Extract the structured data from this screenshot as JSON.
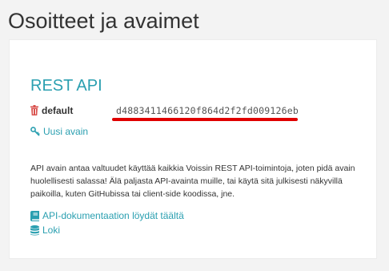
{
  "page": {
    "title": "Osoitteet ja avaimet"
  },
  "rest_api": {
    "title": "REST API",
    "key": {
      "name": "default",
      "value": "d4883411466120f864d2f2fd009126eb",
      "delete_icon": "trash-icon"
    },
    "new_key": {
      "label": "Uusi avain",
      "icon": "key-icon"
    },
    "description": "API avain antaa valtuudet käyttää kaikkia Voissin REST API-toimintoja, joten pidä avain huolellisesti salassa! Älä paljasta API-avainta muille, tai käytä sitä julkisesti näkyvillä paikoilla, kuten GitHubissa tai client-side koodissa, jne.",
    "links": {
      "docs_label": "API-dokumentaation löydät täältä",
      "docs_icon": "book-icon",
      "log_label": "Loki",
      "log_icon": "database-icon"
    }
  },
  "colors": {
    "accent": "#2a9fb0",
    "delete": "#d9534f",
    "highlight": "#e00000"
  }
}
